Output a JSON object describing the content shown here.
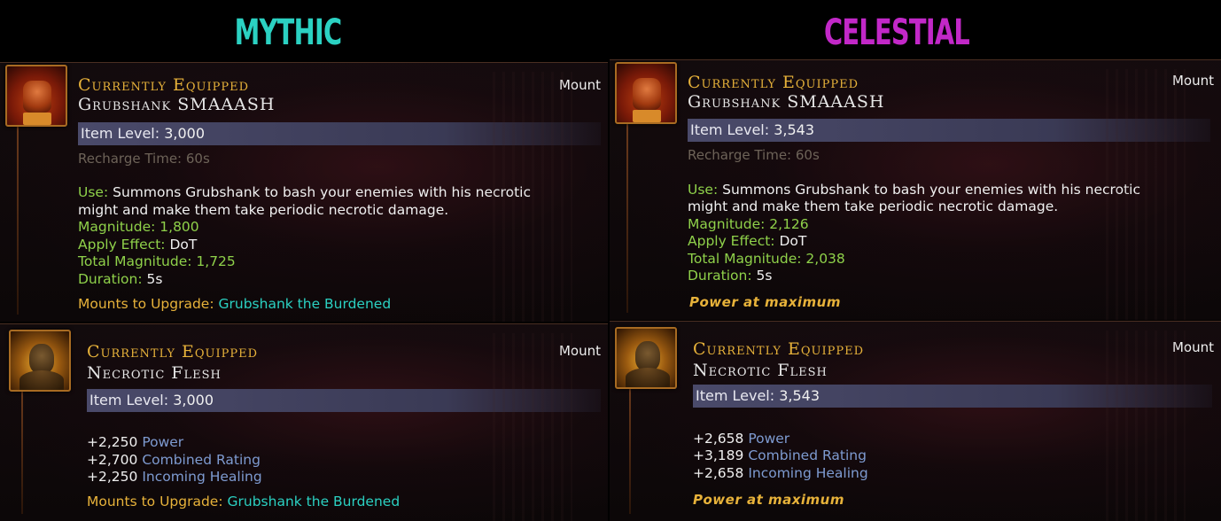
{
  "columns": {
    "mythic": {
      "title": "MYTHIC",
      "color": "#2bd1c2"
    },
    "celestial": {
      "title": "CELESTIAL",
      "color": "#c228c8"
    }
  },
  "mythic_smash": {
    "status": "Currently Equipped",
    "name": "Grubshank SMAAASH",
    "type": "Mount",
    "item_level_label": "Item Level:",
    "item_level": "3,000",
    "recharge": "Recharge Time: 60s",
    "use_label": "Use:",
    "use_text_1": "Summons Grubshank to bash your enemies with his necrotic",
    "use_text_2": "might and make them take periodic necrotic damage.",
    "magnitude_label": "Magnitude:",
    "magnitude": "1,800",
    "apply_label": "Apply Effect:",
    "apply": "DoT",
    "total_label": "Total Magnitude:",
    "total": "1,725",
    "duration_label": "Duration:",
    "duration": "5s",
    "upgrade_label": "Mounts to Upgrade:",
    "upgrade": "Grubshank the Burdened",
    "icon": "fist-icon"
  },
  "celestial_smash": {
    "status": "Currently Equipped",
    "name": "Grubshank SMAAASH",
    "type": "Mount",
    "item_level_label": "Item Level:",
    "item_level": "3,543",
    "recharge": "Recharge Time: 60s",
    "use_label": "Use:",
    "use_text_1": "Summons Grubshank to bash your enemies with his necrotic",
    "use_text_2": "might and make them take periodic necrotic damage.",
    "magnitude_label": "Magnitude:",
    "magnitude": "2,126",
    "apply_label": "Apply Effect:",
    "apply": "DoT",
    "total_label": "Total Magnitude:",
    "total": "2,038",
    "duration_label": "Duration:",
    "duration": "5s",
    "power_max": "Power at maximum",
    "icon": "fist-icon"
  },
  "mythic_flesh": {
    "status": "Currently Equipped",
    "name": "Necrotic Flesh",
    "type": "Mount",
    "item_level_label": "Item Level:",
    "item_level": "3,000",
    "stat1_value": "+2,250",
    "stat1_name": "Power",
    "stat2_value": "+2,700",
    "stat2_name": "Combined Rating",
    "stat3_value": "+2,250",
    "stat3_name": "Incoming Healing",
    "upgrade_label": "Mounts to Upgrade:",
    "upgrade": "Grubshank the Burdened",
    "icon": "ogre-portrait-icon"
  },
  "celestial_flesh": {
    "status": "Currently Equipped",
    "name": "Necrotic Flesh",
    "type": "Mount",
    "item_level_label": "Item Level:",
    "item_level": "3,543",
    "stat1_value": "+2,658",
    "stat1_name": "Power",
    "stat2_value": "+3,189",
    "stat2_name": "Combined Rating",
    "stat3_value": "+2,658",
    "stat3_name": "Incoming Healing",
    "power_max": "Power at maximum",
    "icon": "ogre-portrait-icon"
  }
}
